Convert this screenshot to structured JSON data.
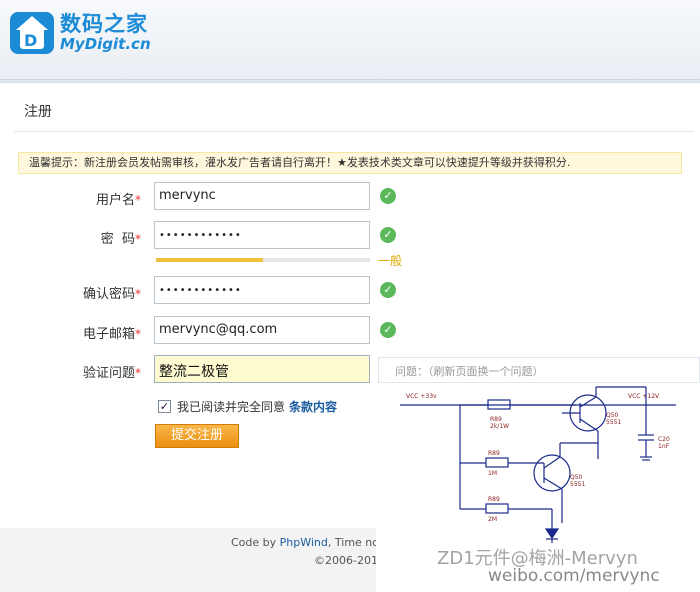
{
  "header": {
    "logo_cn": "数码之家",
    "logo_en_prefix": "MyDigit",
    "logo_en_suffix": ".cn"
  },
  "panel": {
    "title": "注册",
    "notice": "温馨提示：新注册会员发帖需审核，灌水发广告者请自行离开！★发表技术类文章可以快速提升等级并获得积分."
  },
  "form": {
    "required_mark": "*",
    "username": {
      "label": "用户名",
      "value": "mervync"
    },
    "password": {
      "label": "密  码",
      "value": "••••••••••••"
    },
    "strength": {
      "label": "一般",
      "level": 0.5,
      "color": "#f0c23b"
    },
    "confirm": {
      "label": "确认密码",
      "value": "••••••••••••"
    },
    "email": {
      "label": "电子邮箱",
      "value": "mervync@qq.com"
    },
    "question": {
      "label": "验证问题",
      "value": "整流二极管",
      "hint": "问题：（刷新页面换一个问题）"
    },
    "agree": {
      "text": "我已阅读并完全同意",
      "terms": "条款内容",
      "checked": true
    },
    "submit_label": "提交注册",
    "ok_icon": "check-circle-icon",
    "ok_color": "#5cb85c"
  },
  "circuit": {
    "vcc_left": "VCC +33v",
    "vcc_right": "VCC +12V",
    "r89_top": "R89",
    "r89_top_val": "2k/1W",
    "r89_mid": "R89",
    "r89_mid_val": "1M",
    "r89_bot": "R89",
    "r89_bot_val": "2M",
    "q_top": "Q50",
    "q_top_val": "5551",
    "q_mid": "Q50",
    "q_mid_val": "5551",
    "cap": "C20",
    "cap_val": "1nF"
  },
  "watermarks": {
    "line1": "ZD1元件@梅洲-Mervyn",
    "line2": "weibo.com/mervync"
  },
  "footer": {
    "code_by": "Code by",
    "phpwind": "PhpWind",
    "time": ", Time now",
    "copyright": "©2006-201"
  }
}
